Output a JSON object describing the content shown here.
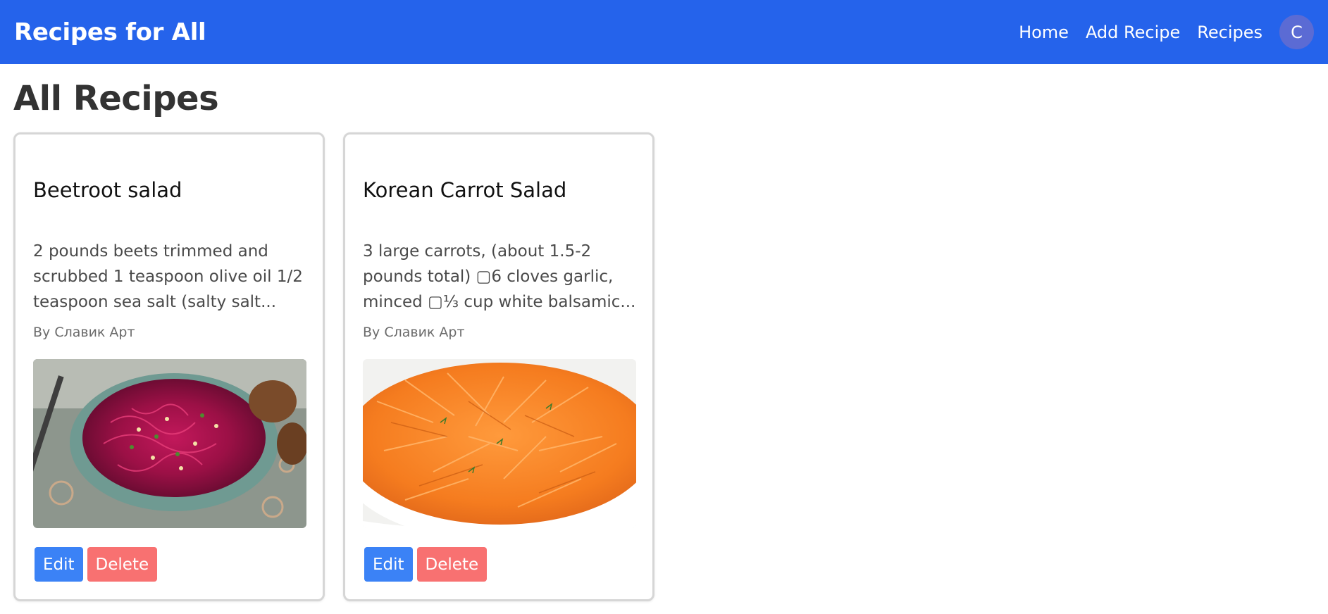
{
  "navbar": {
    "brand": "Recipes for All",
    "links": [
      "Home",
      "Add Recipe",
      "Recipes"
    ],
    "avatar_initial": "C",
    "background_color": "#2563eb"
  },
  "main": {
    "title": "All Recipes",
    "recipes": [
      {
        "title": "Beetroot salad",
        "description": "2 pounds beets trimmed and scrubbed 1 teaspoon olive oil 1/2 teaspoon sea salt (salty salt...",
        "author": "By Славик Арт",
        "image_icon": "beetroot-salad-image",
        "edit_label": "Edit",
        "delete_label": "Delete"
      },
      {
        "title": "Korean Carrot Salad",
        "description": "3 large carrots, (about 1.5-2 pounds total) ▢6 cloves garlic, minced ▢⅓ cup white balsamic...",
        "author": "By Славик Арт",
        "image_icon": "carrot-salad-image",
        "edit_label": "Edit",
        "delete_label": "Delete"
      }
    ]
  },
  "colors": {
    "edit_button": "#3b82f6",
    "delete_button": "#f87171"
  }
}
